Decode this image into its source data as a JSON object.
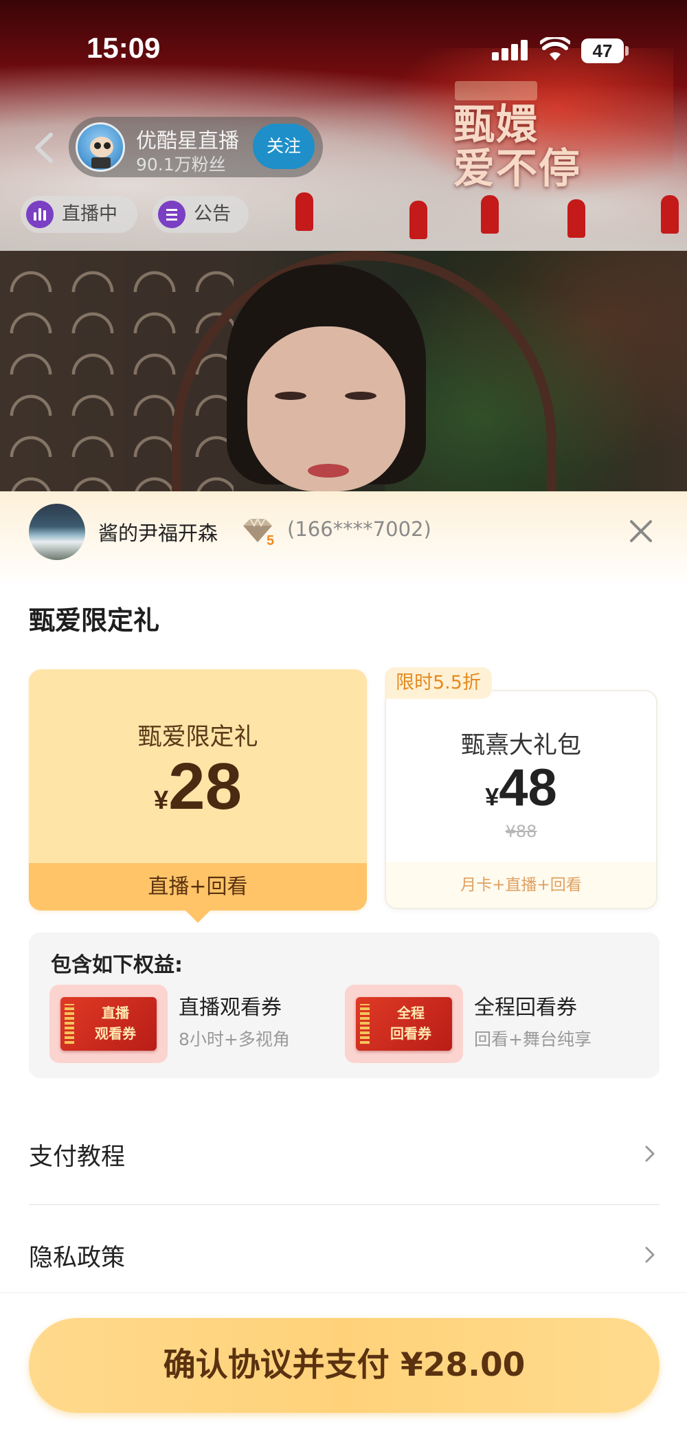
{
  "status_bar": {
    "time": "15:09",
    "battery": "47"
  },
  "live_header": {
    "channel_name": "优酷星直播",
    "fans": "90.1万粉丝",
    "follow_label": "关注",
    "live_tag": "直播中",
    "notice_tag": "公告",
    "show_title_line1": "甄嬛",
    "show_title_line2": "爱不停"
  },
  "account": {
    "name": "酱的尹福开森",
    "vip_level": "5",
    "phone": "(166****7002)"
  },
  "sheet": {
    "title": "甄爱限定礼"
  },
  "packages": [
    {
      "name": "甄爱限定礼",
      "currency": "¥",
      "price": "28",
      "feature": "直播+回看",
      "selected": true
    },
    {
      "badge": "限时5.5折",
      "name": "甄熹大礼包",
      "currency": "¥",
      "price": "48",
      "original_price": "¥88",
      "feature": "月卡+直播+回看",
      "selected": false
    }
  ],
  "benefits": {
    "title": "包含如下权益:",
    "items": [
      {
        "ticket_line1": "直播",
        "ticket_line2": "观看券",
        "name": "直播观看券",
        "desc": "8小时+多视角"
      },
      {
        "ticket_line1": "全程",
        "ticket_line2": "回看券",
        "name": "全程回看券",
        "desc": "回看+舞台纯享"
      }
    ]
  },
  "menu": [
    {
      "label": "支付教程"
    },
    {
      "label": "隐私政策"
    }
  ],
  "pay_button": {
    "label": "确认协议并支付 ¥28.00"
  },
  "colors": {
    "accent": "#ffc468",
    "card_selected_bg": "#ffe4a8",
    "discount_text": "#e48a1e",
    "follow_button": "#1e8fc9",
    "pay_button": "#ffd27a"
  }
}
